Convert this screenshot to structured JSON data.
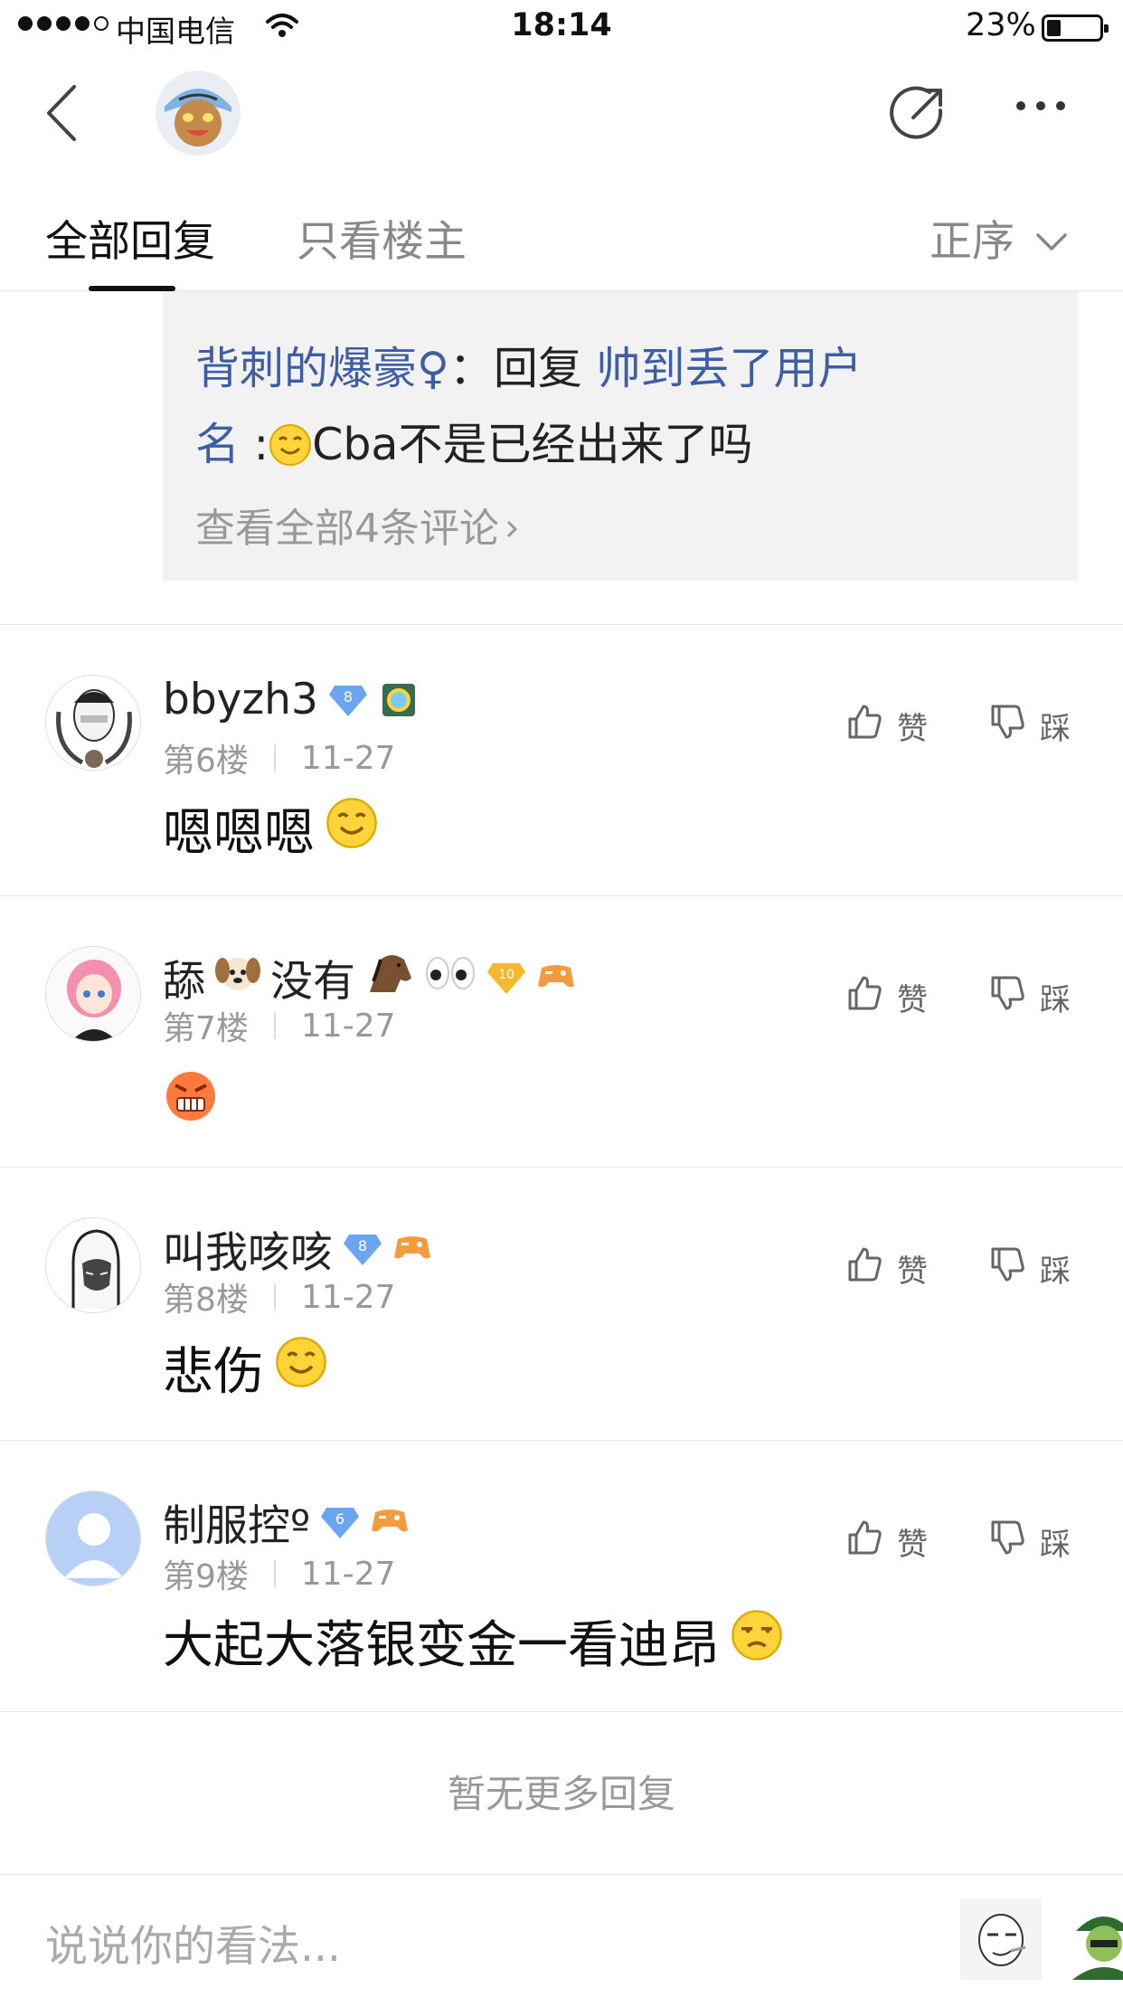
{
  "status_bar": {
    "carrier": "中国电信",
    "time": "18:14",
    "battery": "23%"
  },
  "nav": {
    "back_icon": "chevron-left-icon",
    "share_icon": "share-icon",
    "more_icon": "more-icon"
  },
  "tabs": {
    "all_replies": "全部回复",
    "op_only": "只看楼主",
    "sort_label": "正序"
  },
  "quote": {
    "user": "背刺的爆豪♀",
    "colon": "：",
    "reply_word": "回复",
    "reply_to_line1": "帅到丢了用户",
    "reply_to_line2": "名",
    "colon2": ":",
    "message": "Cba不是已经出来了吗",
    "view_all": "查看全部4条评论"
  },
  "posts": [
    {
      "username": "bbyzh3",
      "level": "8",
      "floor": "第6楼",
      "date": "11-27",
      "content": "嗯嗯嗯",
      "like": "赞",
      "dislike": "踩"
    },
    {
      "username_part1": "舔",
      "username_part2": "没有",
      "level": "10",
      "floor": "第7楼",
      "date": "11-27",
      "like": "赞",
      "dislike": "踩"
    },
    {
      "username": "叫我咳咳",
      "level": "8",
      "floor": "第8楼",
      "date": "11-27",
      "content": "悲伤",
      "like": "赞",
      "dislike": "踩"
    },
    {
      "username": "制服控º",
      "level": "6",
      "floor": "第9楼",
      "date": "11-27",
      "content": "大起大落银变金一看迪昂",
      "like": "赞",
      "dislike": "踩"
    }
  ],
  "no_more": "暂无更多回复",
  "bottom": {
    "placeholder": "说说你的看法..."
  },
  "colors": {
    "link_blue": "#3d5ea5",
    "badge_blue": "#6aa6ef",
    "badge_gold": "#f5b82e",
    "emoji_yellow": "#ffd43b"
  }
}
